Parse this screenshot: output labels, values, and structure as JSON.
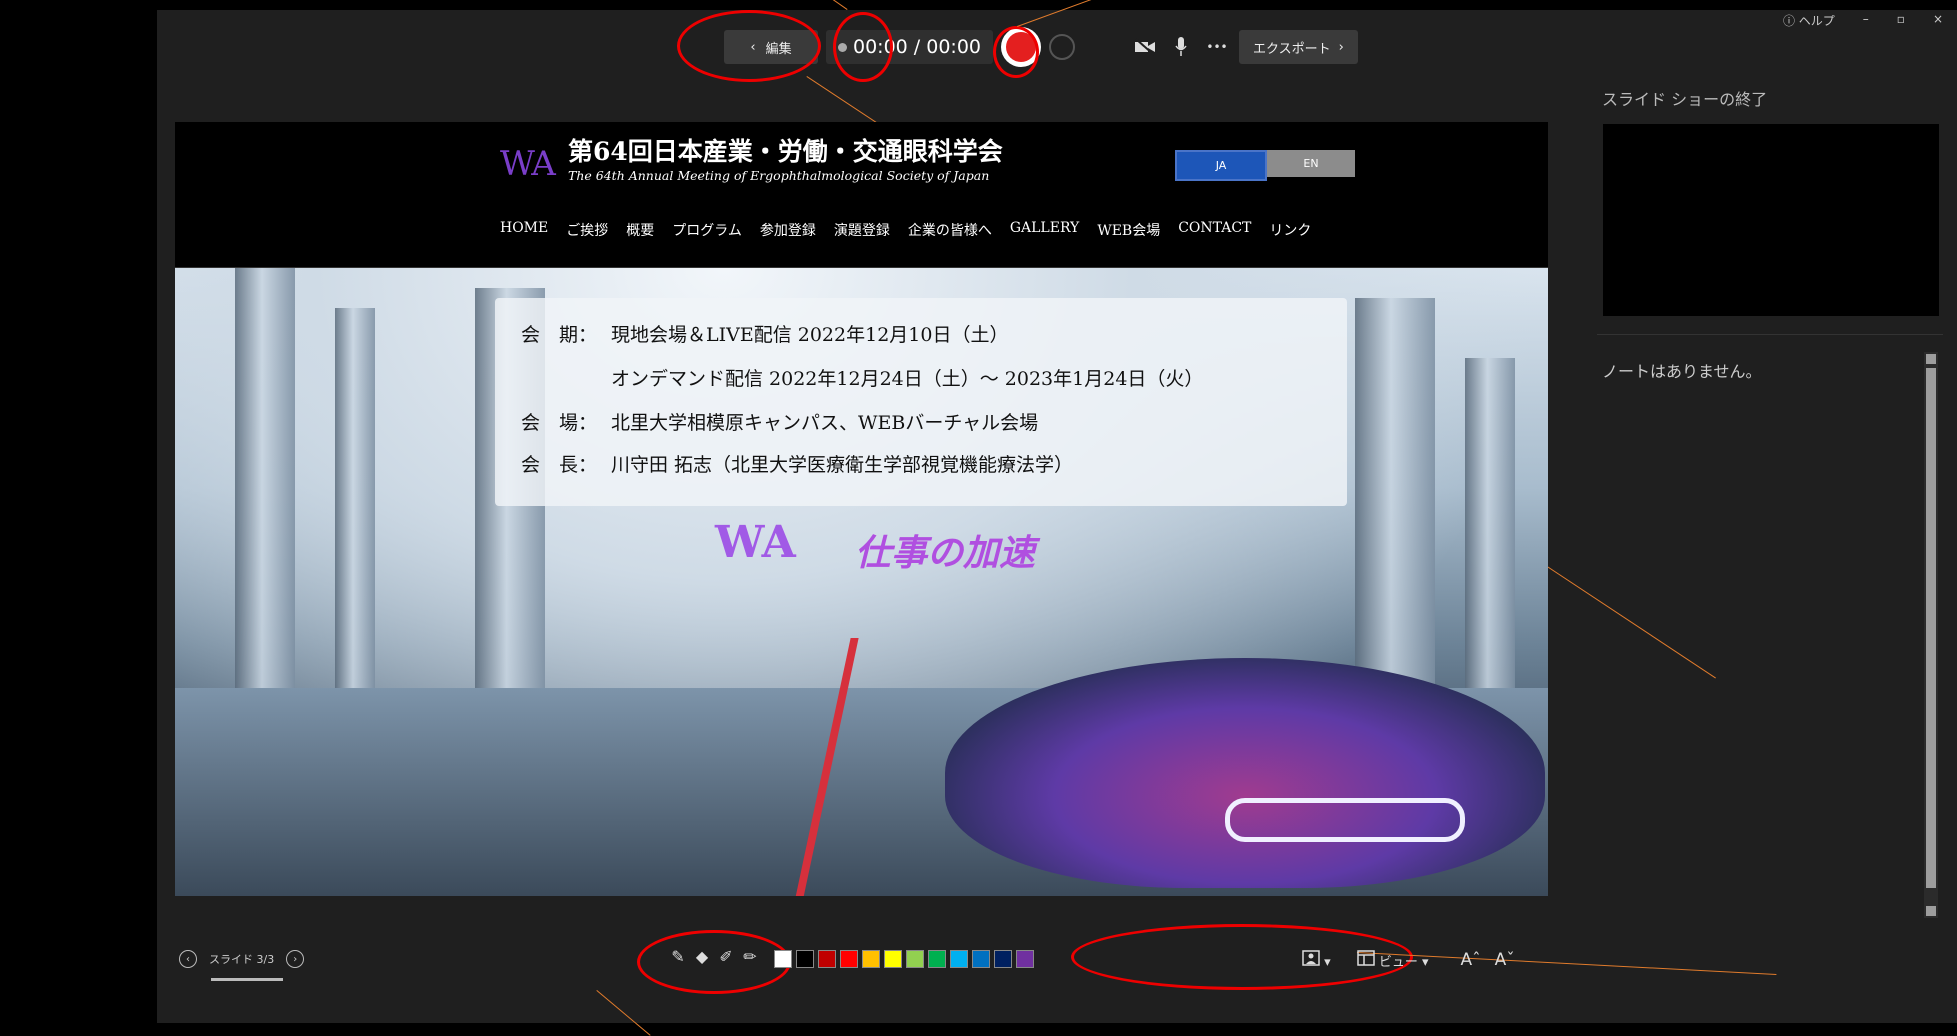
{
  "toolbar": {
    "edit_label": "編集",
    "timer": "00:00 / 00:00",
    "export_label": "エクスポート",
    "more_label": "•••"
  },
  "window": {
    "help": "ヘルプ",
    "minimize": "–",
    "restore": "▫",
    "close": "×"
  },
  "slide": {
    "logo_text": "WA",
    "title": "第64回日本産業・労働・交通眼科学会",
    "subtitle": "The 64th Annual Meeting of Ergophthalmological Society of Japan",
    "lang": [
      "JA",
      "EN"
    ],
    "nav": [
      "HOME",
      "ご挨拶",
      "概要",
      "プログラム",
      "参加登録",
      "演題登録",
      "企業の皆様へ",
      "GALLERY",
      "WEB会場",
      "CONTACT",
      "リンク"
    ],
    "info": [
      {
        "label": "会　期：",
        "text": "現地会場＆LIVE配信 2022年12月10日（土）"
      },
      {
        "label": "",
        "text": "オンデマンド配信 2022年12月24日（土）～ 2023年1月24日（火）"
      },
      {
        "label": "会　場：",
        "text": "北里大学相模原キャンパス、WEBバーチャル会場"
      },
      {
        "label": "会　長：",
        "text": "川守田 拓志（北里大学医療衛生学部視覚機能療法学）"
      }
    ],
    "tagline_logo": "WA",
    "tagline": "仕事の加速"
  },
  "side": {
    "end_show": "スライド ショーの終了",
    "notes": "ノートはありません。"
  },
  "bottom": {
    "slide_counter": "スライド 3/3",
    "view_label": "ビュー",
    "font_up": "Aˆ",
    "font_down": "Aˇ",
    "colors": [
      "#ffffff",
      "#000000",
      "#c00000",
      "#ff0000",
      "#ffc000",
      "#ffff00",
      "#92d050",
      "#00b050",
      "#00b0f0",
      "#0070c0",
      "#002060",
      "#7030a0"
    ]
  }
}
